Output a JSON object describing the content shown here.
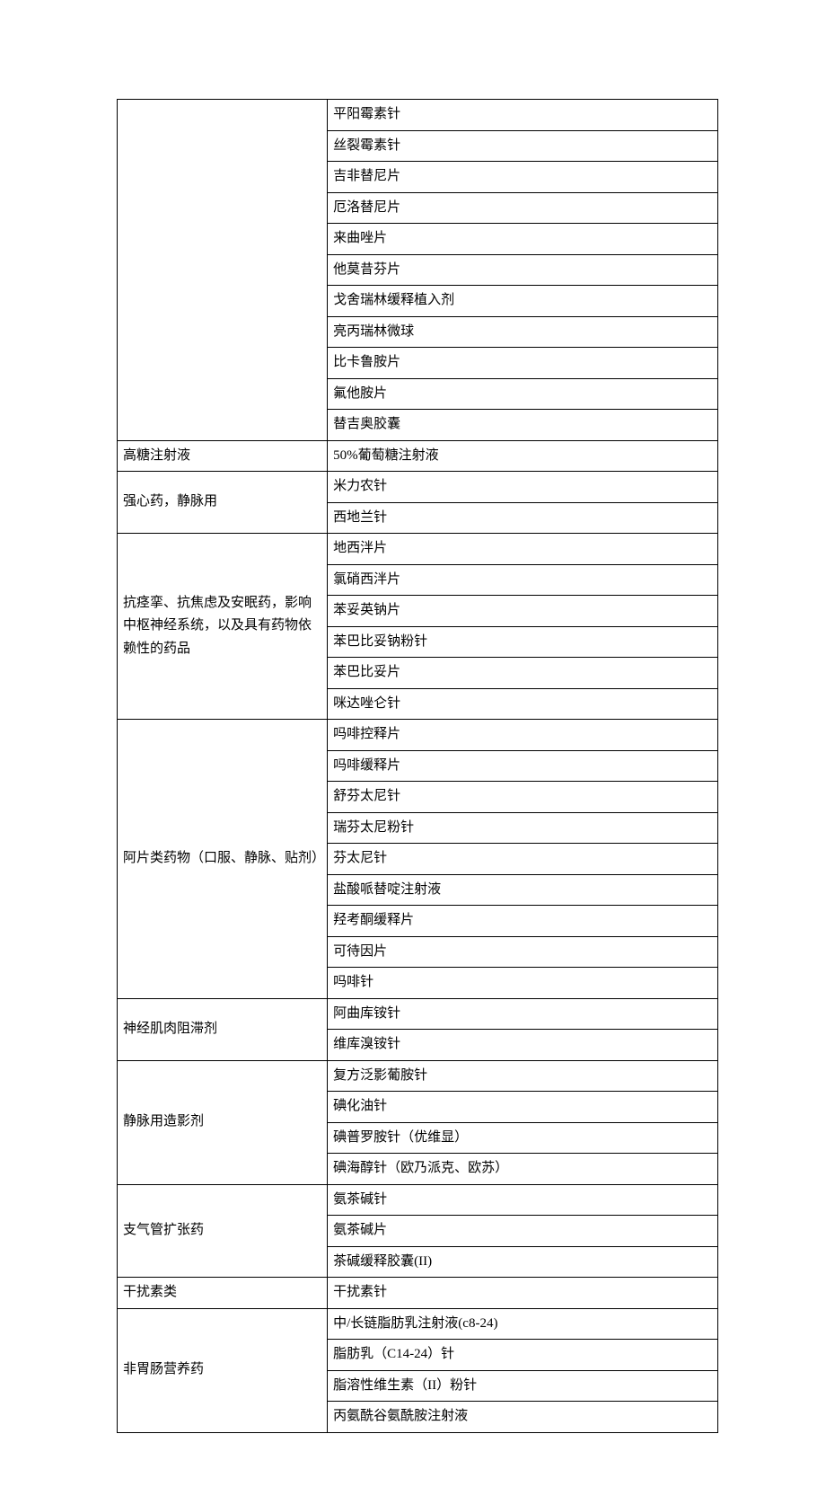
{
  "groups": [
    {
      "category": "",
      "items": [
        "平阳霉素针",
        "丝裂霉素针",
        "吉非替尼片",
        "厄洛替尼片",
        "来曲唑片",
        "他莫昔芬片",
        "戈舍瑞林缓释植入剂",
        "亮丙瑞林微球",
        "比卡鲁胺片",
        "氟他胺片",
        "替吉奥胶囊"
      ]
    },
    {
      "category": "高糖注射液",
      "items": [
        "50%葡萄糖注射液"
      ]
    },
    {
      "category": "强心药，静脉用",
      "items": [
        "米力农针",
        "西地兰针"
      ]
    },
    {
      "category": "抗痉挛、抗焦虑及安眠药，影响中枢神经系统，以及具有药物依赖性的药品",
      "items": [
        "地西泮片",
        "氯硝西泮片",
        "苯妥英钠片",
        "苯巴比妥钠粉针",
        "苯巴比妥片",
        "咪达唑仑针"
      ]
    },
    {
      "category": "阿片类药物（口服、静脉、贴剂）",
      "items": [
        "吗啡控释片",
        "吗啡缓释片",
        "舒芬太尼针",
        "瑞芬太尼粉针",
        "芬太尼针",
        "盐酸哌替啶注射液",
        "羟考酮缓释片",
        "可待因片",
        "吗啡针"
      ]
    },
    {
      "category": "神经肌肉阻滞剂",
      "items": [
        "阿曲库铵针",
        "维库溴铵针"
      ]
    },
    {
      "category": "静脉用造影剂",
      "items": [
        "复方泛影葡胺针",
        "碘化油针",
        "碘普罗胺针（优维显）",
        "碘海醇针（欧乃派克、欧苏）"
      ]
    },
    {
      "category": "支气管扩张药",
      "items": [
        "氨茶碱针",
        "氨茶碱片",
        "茶碱缓释胶囊(II)"
      ]
    },
    {
      "category": "干扰素类",
      "items": [
        "干扰素针"
      ]
    },
    {
      "category": "非胃肠营养药",
      "items": [
        "中/长链脂肪乳注射液(c8-24)",
        "脂肪乳（C14-24）针",
        "脂溶性维生素（II）粉针",
        "丙氨酰谷氨酰胺注射液"
      ]
    }
  ]
}
